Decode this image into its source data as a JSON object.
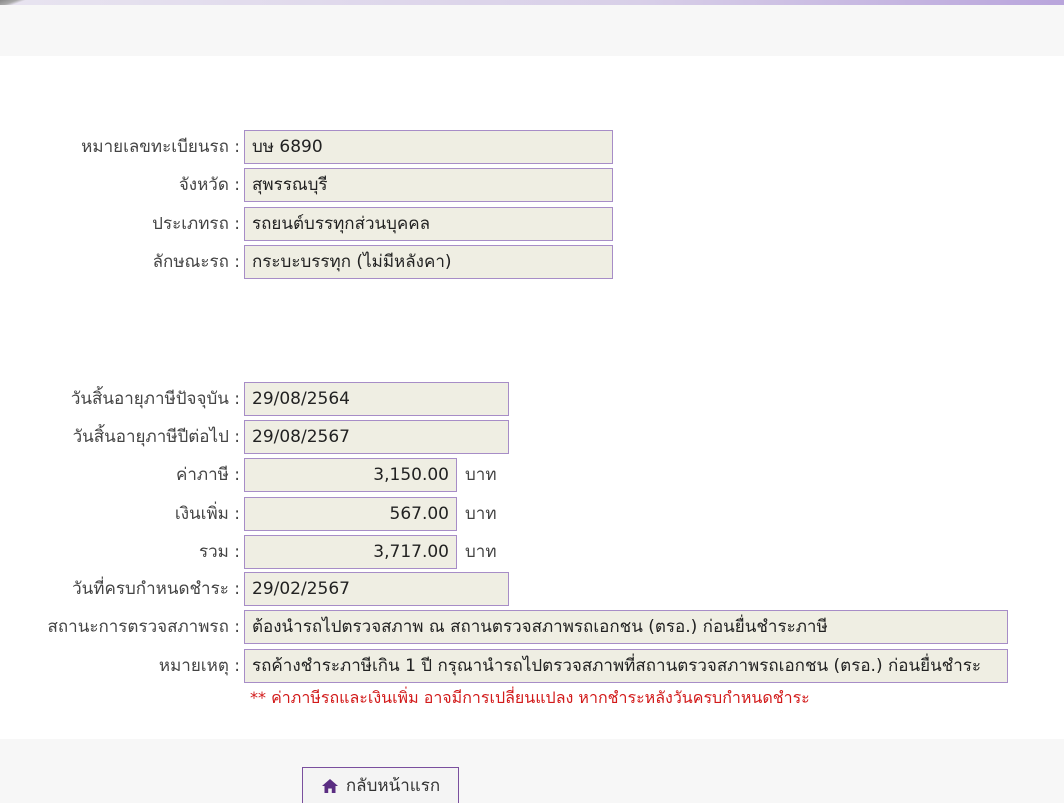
{
  "vehicle": {
    "plate_label": "หมายเลขทะเบียนรถ :",
    "plate_value": "บษ 6890",
    "province_label": "จังหวัด :",
    "province_value": "สุพรรณบุรี",
    "type_label": "ประเภทรถ :",
    "type_value": "รถยนต์บรรทุกส่วนบุคคล",
    "style_label": "ลักษณะรถ :",
    "style_value": "กระบะบรรทุก (ไม่มีหลังคา)"
  },
  "tax": {
    "current_expiry_label": "วันสิ้นอายุภาษีปัจจุบัน :",
    "current_expiry_value": "29/08/2564",
    "next_expiry_label": "วันสิ้นอายุภาษีปีต่อไป :",
    "next_expiry_value": "29/08/2567",
    "tax_label": "ค่าภาษี :",
    "tax_value": "3,150.00",
    "surcharge_label": "เงินเพิ่ม :",
    "surcharge_value": "567.00",
    "total_label": "รวม :",
    "total_value": "3,717.00",
    "unit": "บาท",
    "due_date_label": "วันที่ครบกำหนดชำระ :",
    "due_date_value": "29/02/2567",
    "inspection_label": "สถานะการตรวจสภาพรถ :",
    "inspection_value": "ต้องนำรถไปตรวจสภาพ ณ สถานตรวจสภาพรถเอกชน (ตรอ.) ก่อนยื่นชำระภาษี",
    "remark_label": "หมายเหตุ :",
    "remark_value": "รถค้างชำระภาษีเกิน 1 ปี กรุณานำรถไปตรวจสภาพที่สถานตรวจสภาพรถเอกชน (ตรอ.) ก่อนยื่นชำระ",
    "warning_note": "** ค่าภาษีรถและเงินเพิ่ม อาจมีการเปลี่ยนแปลง หากชำระหลังวันครบกำหนดชำระ"
  },
  "actions": {
    "home_label": "กลับหน้าแรก",
    "home_icon": "home-icon"
  },
  "colors": {
    "field_bg": "#efeee3",
    "field_border": "#a78dc7",
    "warning": "#d21a1a",
    "accent": "#7a4f9e"
  }
}
